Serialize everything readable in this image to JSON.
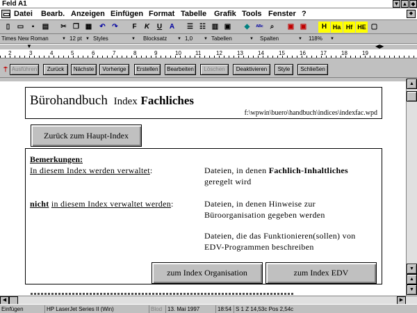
{
  "window": {
    "title": "Feld A1"
  },
  "menu": {
    "items": [
      "Datei",
      "Bearb.",
      "Anzeigen",
      "Einfügen",
      "Format",
      "Tabelle",
      "Grafik",
      "Tools",
      "Fenster",
      "?"
    ]
  },
  "toolbar": {
    "buttons": [
      {
        "name": "new-document-icon",
        "glyph": "▯"
      },
      {
        "name": "open-folder-icon",
        "glyph": "▭"
      },
      {
        "name": "save-icon",
        "glyph": "▪"
      },
      {
        "name": "print-icon",
        "glyph": "▤"
      },
      {
        "name": "cut-icon",
        "glyph": "✂"
      },
      {
        "name": "copy-icon",
        "glyph": "❐"
      },
      {
        "name": "paste-icon",
        "glyph": "▦"
      },
      {
        "name": "undo-icon",
        "glyph": "↶"
      },
      {
        "name": "redo-icon",
        "glyph": "↷"
      },
      {
        "name": "bold-icon",
        "glyph": "F"
      },
      {
        "name": "italic-icon",
        "glyph": "K"
      },
      {
        "name": "underline-icon",
        "glyph": "U"
      },
      {
        "name": "font-icon",
        "glyph": "A"
      },
      {
        "name": "bullet-list-icon",
        "glyph": "☰"
      },
      {
        "name": "numbered-list-icon",
        "glyph": "☷"
      },
      {
        "name": "zoom-page-icon",
        "glyph": "▣"
      },
      {
        "name": "qa-diamond-icon",
        "glyph": "◆"
      },
      {
        "name": "spellcheck-icon",
        "glyph": "ᴬᴮᶜ"
      },
      {
        "name": "find-icon",
        "glyph": "⌕"
      },
      {
        "name": "format-table-icon",
        "glyph": "▥"
      },
      {
        "name": "hypertext-icon",
        "glyph": "H"
      },
      {
        "name": "hypertext-ha-icon",
        "glyph": "Ha"
      },
      {
        "name": "hypertext-hf-icon",
        "glyph": "Hf"
      },
      {
        "name": "hypertext-he-icon",
        "glyph": "HE"
      },
      {
        "name": "book-icon",
        "glyph": "▢"
      }
    ]
  },
  "ribbon": {
    "font": "Times New Roman",
    "size": "12 pt",
    "styles": "Styles",
    "justify": "Blocksatz",
    "spacing": "1,0",
    "tables": "Tabellen",
    "columns": "Spalten",
    "zoom": "118%"
  },
  "ruler": {
    "numbers": [
      "2",
      "3",
      "4",
      "5",
      "6",
      "7",
      "8",
      "9",
      "10",
      "11",
      "12",
      "13",
      "14",
      "15",
      "16",
      "17",
      "18",
      "19"
    ]
  },
  "hypertext_bar": {
    "buttons": [
      {
        "label": "Ausführen",
        "enabled": false
      },
      {
        "label": "Zurück",
        "enabled": true
      },
      {
        "label": "Nächste",
        "enabled": true
      },
      {
        "label": "Vorherige",
        "enabled": true
      },
      {
        "label": "Erstellen",
        "enabled": true
      },
      {
        "label": "Bearbeiten",
        "enabled": true
      },
      {
        "label": "Löschen",
        "enabled": false
      },
      {
        "label": "Deaktivieren",
        "enabled": true
      },
      {
        "label": "Style",
        "enabled": true
      },
      {
        "label": "Schließen",
        "enabled": true
      }
    ]
  },
  "document": {
    "title_main": "Bürohandbuch",
    "title_index": "Index",
    "title_bold": "Fachliches",
    "path": "f:\\wpwin\\buero\\handbuch\\indices\\indexfac.wpd",
    "back_button": "Zurück zum Haupt-Index",
    "remarks_heading": "Bemerkungen:",
    "managed_label": "In diesem Index werden verwaltet",
    "managed_colon": ":",
    "managed_desc_prefix": "Dateien, in denen",
    "managed_desc_bold": "Fachlich-Inhaltliches",
    "managed_desc_line2": "geregelt wird",
    "not_managed_bold": "nicht",
    "not_managed_label": "in diesem Index verwaltet werden",
    "not_managed_colon": ":",
    "not_managed_desc_line1": "Dateien, in denen Hinweise zur",
    "not_managed_desc_line2": "Büroorganisation gegeben werden",
    "edv_desc_line1": "Dateien, die das Funktionieren(sollen) von",
    "edv_desc_line2": "EDV-Programmen beschreiben",
    "btn_org": "zum Index Organisation",
    "btn_edv": "zum Index EDV"
  },
  "statusbar": {
    "mode": "Einfügen",
    "printer": "HP LaserJet Series II (Win)",
    "block": "Blod",
    "date": "13. Mai 1997",
    "time": "18:54",
    "position": "S 1  Z 14,53c Pos 2,54c"
  },
  "colors": {
    "chrome": "#c0c0c0",
    "shadow": "#808080",
    "disabled": "#808080"
  }
}
